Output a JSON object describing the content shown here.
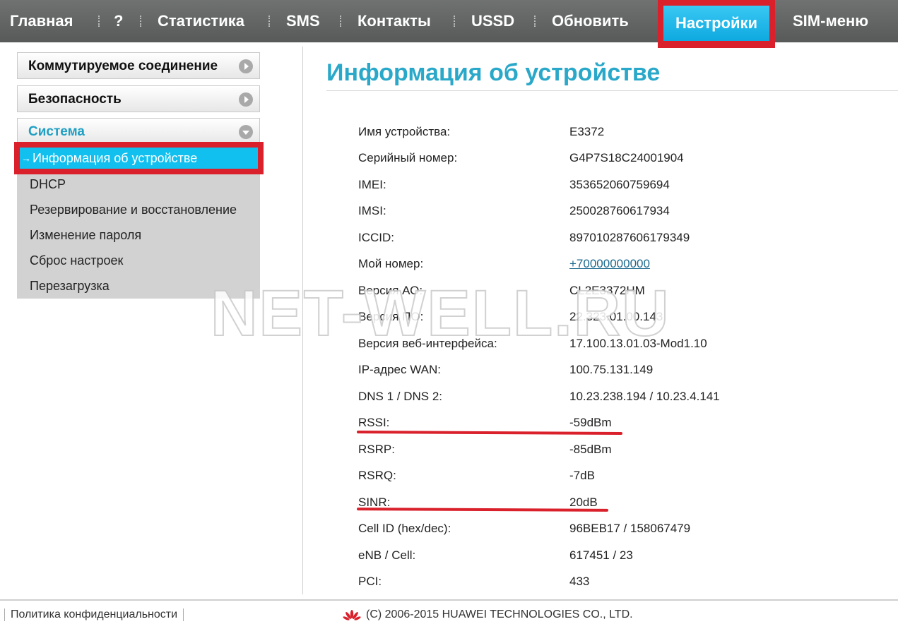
{
  "nav": {
    "items": [
      "Главная",
      "?",
      "Статистика",
      "SMS",
      "Контакты",
      "USSD",
      "Обновить",
      "Настройки",
      "SIM-меню"
    ]
  },
  "sidebar": {
    "sections": [
      "Коммутируемое соединение",
      "Безопасность",
      "Система"
    ],
    "submenu": [
      "Информация об устройстве",
      "DHCP",
      "Резервирование и восстановление",
      "Изменение пароля",
      "Сброс настроек",
      "Перезагрузка"
    ]
  },
  "main": {
    "title": "Информация об устройстве",
    "rows": [
      {
        "label": "Имя устройства:",
        "value": "E3372"
      },
      {
        "label": "Серийный номер:",
        "value": "G4P7S18C24001904"
      },
      {
        "label": "IMEI:",
        "value": "353652060759694"
      },
      {
        "label": "IMSI:",
        "value": "250028760617934"
      },
      {
        "label": "ICCID:",
        "value": "897010287606179349"
      },
      {
        "label": "Мой номер:",
        "value": "+70000000000"
      },
      {
        "label": "Версия АО:",
        "value": "CL2E3372HM"
      },
      {
        "label": "Версия ПО:",
        "value": "22.323.01.00.143"
      },
      {
        "label": "Версия веб-интерфейса:",
        "value": "17.100.13.01.03-Mod1.10"
      },
      {
        "label": "IP-адрес WAN:",
        "value": "100.75.131.149"
      },
      {
        "label": "DNS 1 / DNS 2:",
        "value": "10.23.238.194 / 10.23.4.141"
      },
      {
        "label": "RSSI:",
        "value": "-59dBm"
      },
      {
        "label": "RSRP:",
        "value": "-85dBm"
      },
      {
        "label": "RSRQ:",
        "value": "-7dB"
      },
      {
        "label": "SINR:",
        "value": "20dB"
      },
      {
        "label": "Cell ID (hex/dec):",
        "value": "96BEB17 / 158067479"
      },
      {
        "label": "eNB / Cell:",
        "value": "617451 / 23"
      },
      {
        "label": "PCI:",
        "value": "433"
      }
    ]
  },
  "watermark": "NET-WELL.RU",
  "footer": {
    "privacy": "Политика конфиденциальности",
    "copyright": "(C) 2006-2015 HUAWEI TECHNOLOGIES CO., LTD."
  },
  "colors": {
    "accent": "#2aa8c9",
    "active_tab": "#12c0f0",
    "highlight": "#d9202b",
    "nav_bg": "#636665"
  }
}
